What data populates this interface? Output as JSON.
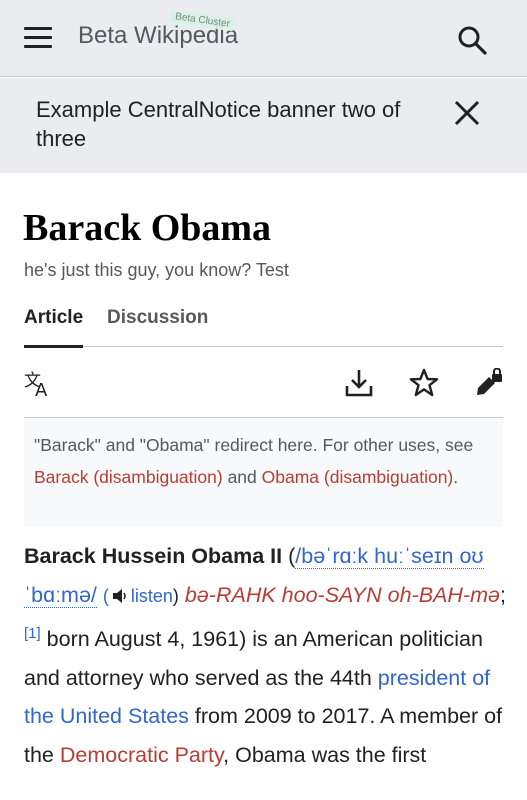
{
  "header": {
    "title": "Beta Wikipedia",
    "beta_badge": "Beta Cluster",
    "menu_icon": "hamburger-icon",
    "search_icon": "search-icon"
  },
  "banner": {
    "text": "Example CentralNotice banner two of three",
    "close_icon": "close-icon"
  },
  "page": {
    "title": "Barack Obama",
    "tagline": "he's just this guy, you know? Test"
  },
  "tabs": [
    {
      "label": "Article",
      "active": true
    },
    {
      "label": "Discussion",
      "active": false
    }
  ],
  "actions": {
    "language_icon": "translate-icon",
    "download_icon": "download-icon",
    "watch_icon": "star-icon",
    "edit_icon": "edit-lock-icon"
  },
  "hatnote": {
    "prefix": "\"Barack\" and \"Obama\" redirect here. For other uses, see ",
    "link1": "Barack (disambiguation)",
    "mid": " and ",
    "link2": "Obama (disambiguation)",
    "suffix": "."
  },
  "article": {
    "bold_name": "Barack Hussein Obama II",
    "open_paren": " (",
    "ipa": "/bəˈrɑːk huːˈseɪn oʊˈbɑːmə/",
    "space": " ",
    "listen_paren_open": "(",
    "listen_label": "listen",
    "listen_paren_close": ")",
    "respell": "bə-RAHK hoo-SAYN oh-BAH-mə",
    "semicolon": ";",
    "ref": "[1]",
    "born": " born August 4, 1961) is an American politician and attorney who served as the 44th ",
    "link_president": "president of the United States",
    "from": " from 2009 to 2017. A member of the ",
    "link_party": "Democratic Party",
    "rest": ", Obama was the first"
  },
  "colors": {
    "header_bg": "#eaecf0",
    "link_blue": "#3366cc",
    "link_red": "#ba3c33"
  }
}
